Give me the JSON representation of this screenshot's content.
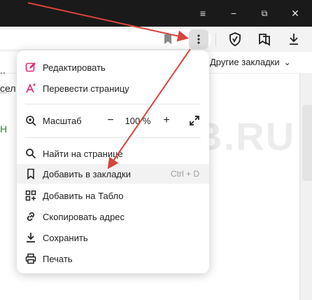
{
  "window": {
    "minimize": "−",
    "restore": "⧉",
    "close": "✕",
    "tabs_menu": "≡"
  },
  "toolbar": {
    "menu_icon": "three-dots-vertical-icon",
    "bookmark_icon": "bookmark-icon",
    "adblock_icon": "shield-check-icon",
    "collections_icon": "collections-icon",
    "download_icon": "download-icon"
  },
  "bookmarks_bar": {
    "other_bookmarks": "Другие закладки",
    "chevron": "⌄"
  },
  "page_fragments": {
    "line1": "..",
    "line2": "сел",
    "line3": "Н"
  },
  "menu": {
    "edit": "Редактировать",
    "translate": "Перевести страницу",
    "zoom_label": "Масштаб",
    "zoom_minus": "−",
    "zoom_value": "100 %",
    "zoom_plus": "+",
    "find": "Найти на странице",
    "add_bookmark": "Добавить в закладки",
    "add_bookmark_shortcut": "Ctrl + D",
    "add_tablo": "Добавить на Табло",
    "copy_address": "Скопировать адрес",
    "save": "Сохранить",
    "print": "Печать"
  },
  "watermark": "DMWEB.RU",
  "colors": {
    "arrow": "#d9453c",
    "edit_icon": "#e0307a",
    "translate_icon": "#e0307a",
    "titlebar": "#1a1a1a"
  }
}
